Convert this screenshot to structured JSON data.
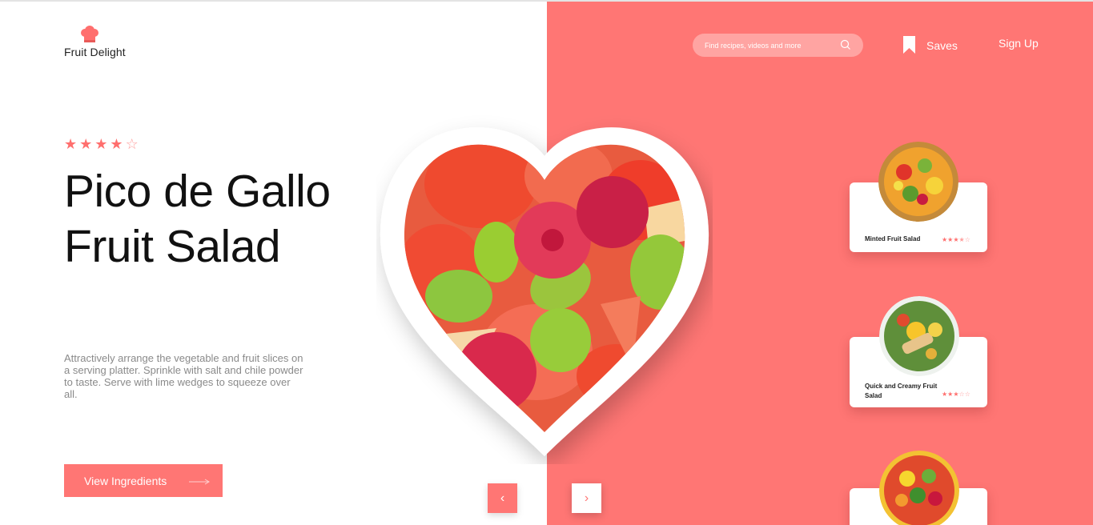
{
  "brand": {
    "name": "Fruit Delight",
    "icon": "chef-hat-icon"
  },
  "header": {
    "search_placeholder": "Find recipes, videos and more",
    "search_icon": "search-icon",
    "saves_label": "Saves",
    "saves_icon": "bookmark-icon",
    "signup_label": "Sign Up"
  },
  "hero": {
    "rating": {
      "stars": [
        "★",
        "★",
        "★",
        "★",
        "☆"
      ],
      "value": 4,
      "max": 5
    },
    "title": "Pico de Gallo Fruit Salad",
    "description": "Attractively arrange the vegetable and fruit slices on a serving platter. Sprinkle with salt and chile powder to taste. Serve with lime wedges to squeeze over all.",
    "cta_label": "View Ingredients",
    "cta_arrow": "⟶"
  },
  "carousel": {
    "prev": "‹",
    "next": "›"
  },
  "recipes": [
    {
      "name": "Minted Fruit Salad",
      "stars": "★★★★☆",
      "rating": 3.5
    },
    {
      "name": "Quick and Creamy Fruit Salad",
      "stars": "★★★☆☆",
      "rating": 3
    },
    {
      "name": "",
      "stars": "",
      "rating": null
    }
  ],
  "colors": {
    "accent": "#ff7674",
    "panel": "#ff7674",
    "text": "#111111",
    "muted": "#8a8a8a"
  }
}
